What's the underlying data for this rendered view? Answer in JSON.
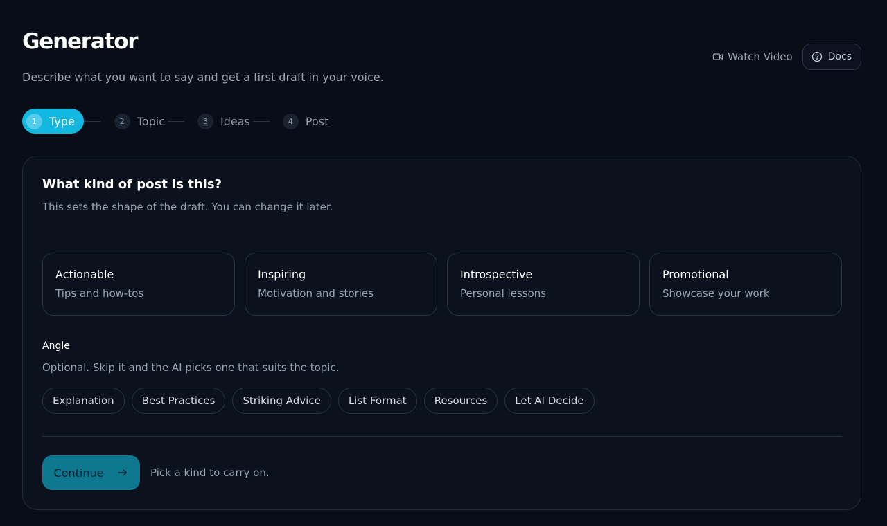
{
  "header": {
    "title": "Generator",
    "subtitle": "Describe what you want to say and get a first draft in your voice.",
    "watch_video_label": "Watch Video",
    "docs_label": "Docs"
  },
  "stepper": {
    "steps": [
      {
        "number": "1",
        "label": "Type",
        "active": true
      },
      {
        "number": "2",
        "label": "Topic",
        "active": false
      },
      {
        "number": "3",
        "label": "Ideas",
        "active": false
      },
      {
        "number": "4",
        "label": "Post",
        "active": false
      }
    ]
  },
  "card": {
    "title": "What kind of post is this?",
    "subtitle": "This sets the shape of the draft. You can change it later.",
    "kinds": [
      {
        "title": "Actionable",
        "desc": "Tips and how-tos"
      },
      {
        "title": "Inspiring",
        "desc": "Motivation and stories"
      },
      {
        "title": "Introspective",
        "desc": "Personal lessons"
      },
      {
        "title": "Promotional",
        "desc": "Showcase your work"
      }
    ],
    "angle_label": "Angle",
    "angle_desc": "Optional. Skip it and the AI picks one that suits the topic.",
    "angles": [
      "Explanation",
      "Best Practices",
      "Striking Advice",
      "List Format",
      "Resources",
      "Let AI Decide"
    ],
    "continue_label": "Continue",
    "continue_hint": "Pick a kind to carry on."
  },
  "icons": {
    "watch_video": "video-camera-icon",
    "docs": "help-circle-icon",
    "continue": "arrow-right-icon"
  },
  "colors": {
    "background": "#080d18",
    "accent": "#12b8e0",
    "continue_button": "#0f7891"
  }
}
